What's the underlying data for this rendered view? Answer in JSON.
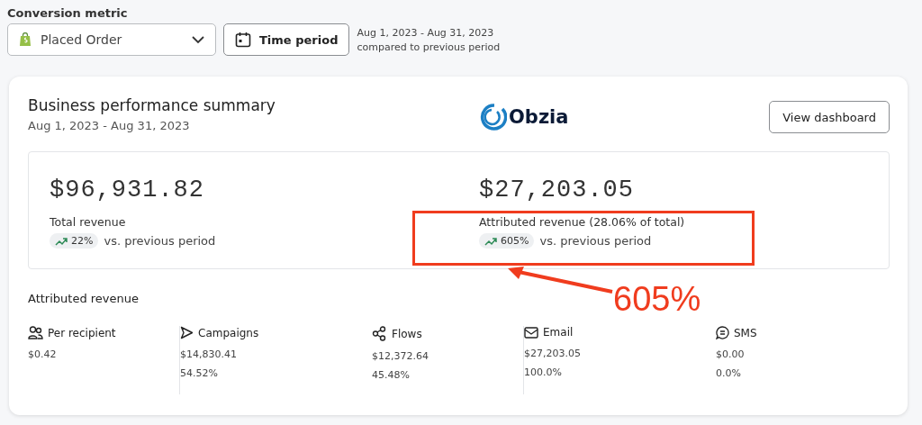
{
  "filters": {
    "label": "Conversion metric",
    "metric": {
      "value": "Placed Order"
    },
    "time_button": "Time period",
    "range": "Aug 1, 2023 - Aug 31, 2023",
    "comparison": "compared to previous period"
  },
  "card": {
    "title": "Business performance summary",
    "subtitle": "Aug 1, 2023 - Aug 31, 2023",
    "logo": "Obzia",
    "button": "View dashboard",
    "totals": [
      {
        "amount": "$96,931.82",
        "label": "Total revenue",
        "change": "22%",
        "suffix": "vs. previous period"
      },
      {
        "amount": "$27,203.05",
        "label": "Attributed revenue (28.06% of total)",
        "change": "605%",
        "suffix": "vs. previous period"
      }
    ],
    "section_title": "Attributed revenue",
    "metrics": [
      {
        "name": "Per recipient",
        "value": "$0.42"
      },
      {
        "name": "Campaigns",
        "value": "$14,830.41",
        "share": "54.52%"
      },
      {
        "name": "Flows",
        "value": "$12,372.64",
        "share": "45.48%"
      },
      {
        "name": "Email",
        "value": "$27,203.05",
        "share": "100.0%"
      },
      {
        "name": "SMS",
        "value": "$0.00",
        "share": "0.0%"
      }
    ]
  },
  "annotation": {
    "text": "605%"
  }
}
